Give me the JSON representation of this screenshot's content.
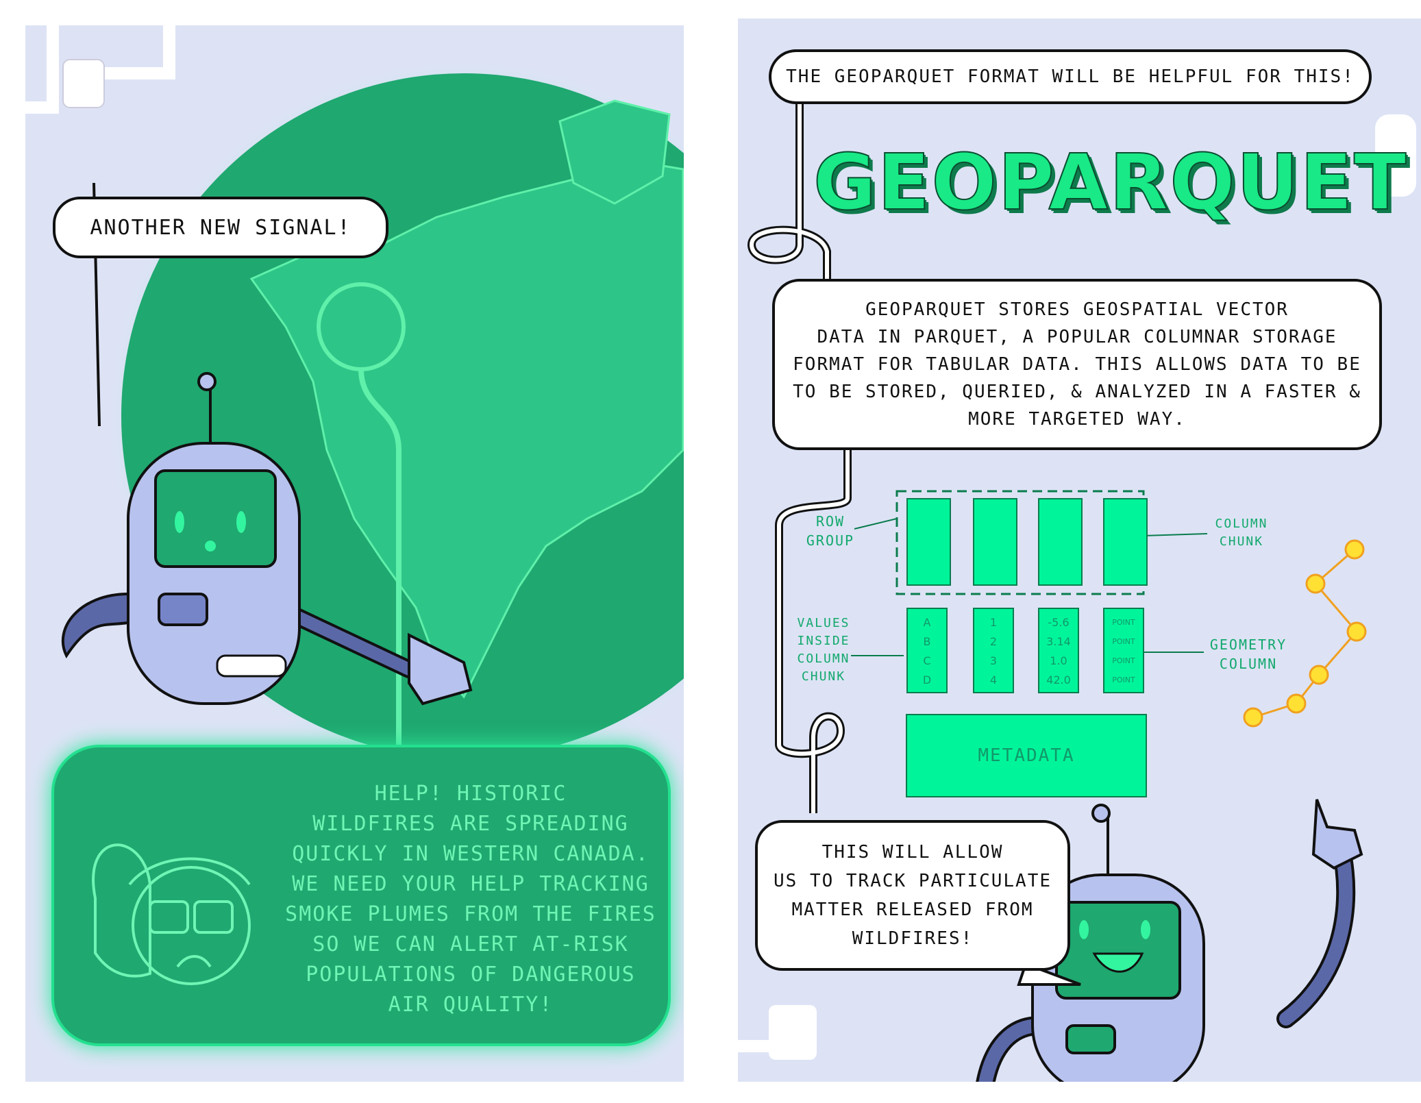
{
  "left_page": {
    "speech_robot": "ANOTHER NEW SIGNAL!",
    "transmission_lines": [
      "HELP! HISTORIC",
      "WILDFIRES ARE SPREADING",
      "QUICKLY IN WESTERN CANADA.",
      "WE NEED YOUR HELP TRACKING",
      "SMOKE PLUMES FROM THE FIRES",
      "SO WE CAN ALERT AT-RISK",
      "POPULATIONS OF DANGEROUS",
      "AIR QUALITY!"
    ]
  },
  "right_page": {
    "speech_top": "THE GEOPARQUET FORMAT WILL BE HELPFUL FOR THIS!",
    "title": "GEOPARQUET",
    "explanation_lines": [
      "GEOPARQUET STORES GEOSPATIAL VECTOR",
      "DATA IN PARQUET, A POPULAR COLUMNAR STORAGE",
      "FORMAT FOR TABULAR DATA. THIS ALLOWS DATA TO BE",
      "TO BE STORED, QUERIED, & ANALYZED IN A FASTER &",
      "MORE TARGETED WAY."
    ],
    "diagram": {
      "row_group_label": [
        "ROW",
        "GROUP"
      ],
      "column_chunk_label": [
        "COLUMN",
        "CHUNK"
      ],
      "values_label": [
        "VALUES",
        "INSIDE",
        "COLUMN",
        "CHUNK"
      ],
      "geometry_label": [
        "GEOMETRY",
        "COLUMN"
      ],
      "col_letters": [
        "A",
        "B",
        "C",
        "D"
      ],
      "col_ints": [
        "1",
        "2",
        "3",
        "4"
      ],
      "col_floats": [
        "-5.6",
        "3.14",
        "1.0",
        "42.0"
      ],
      "col_points": [
        "POINT",
        "POINT",
        "POINT",
        "POINT"
      ],
      "metadata_label": "METADATA"
    },
    "speech_bottom_lines": [
      "THIS WILL ALLOW",
      "US TO TRACK PARTICULATE",
      "MATTER RELEASED FROM",
      "WILDFIRES!"
    ]
  },
  "colors": {
    "page_bg": "#dde3f5",
    "globe_green": "#1fa870",
    "neon_green": "#00f59a",
    "robot_body": "#b8c2ee",
    "robot_arm": "#5b68a8",
    "point_yellow": "#ffe033"
  }
}
